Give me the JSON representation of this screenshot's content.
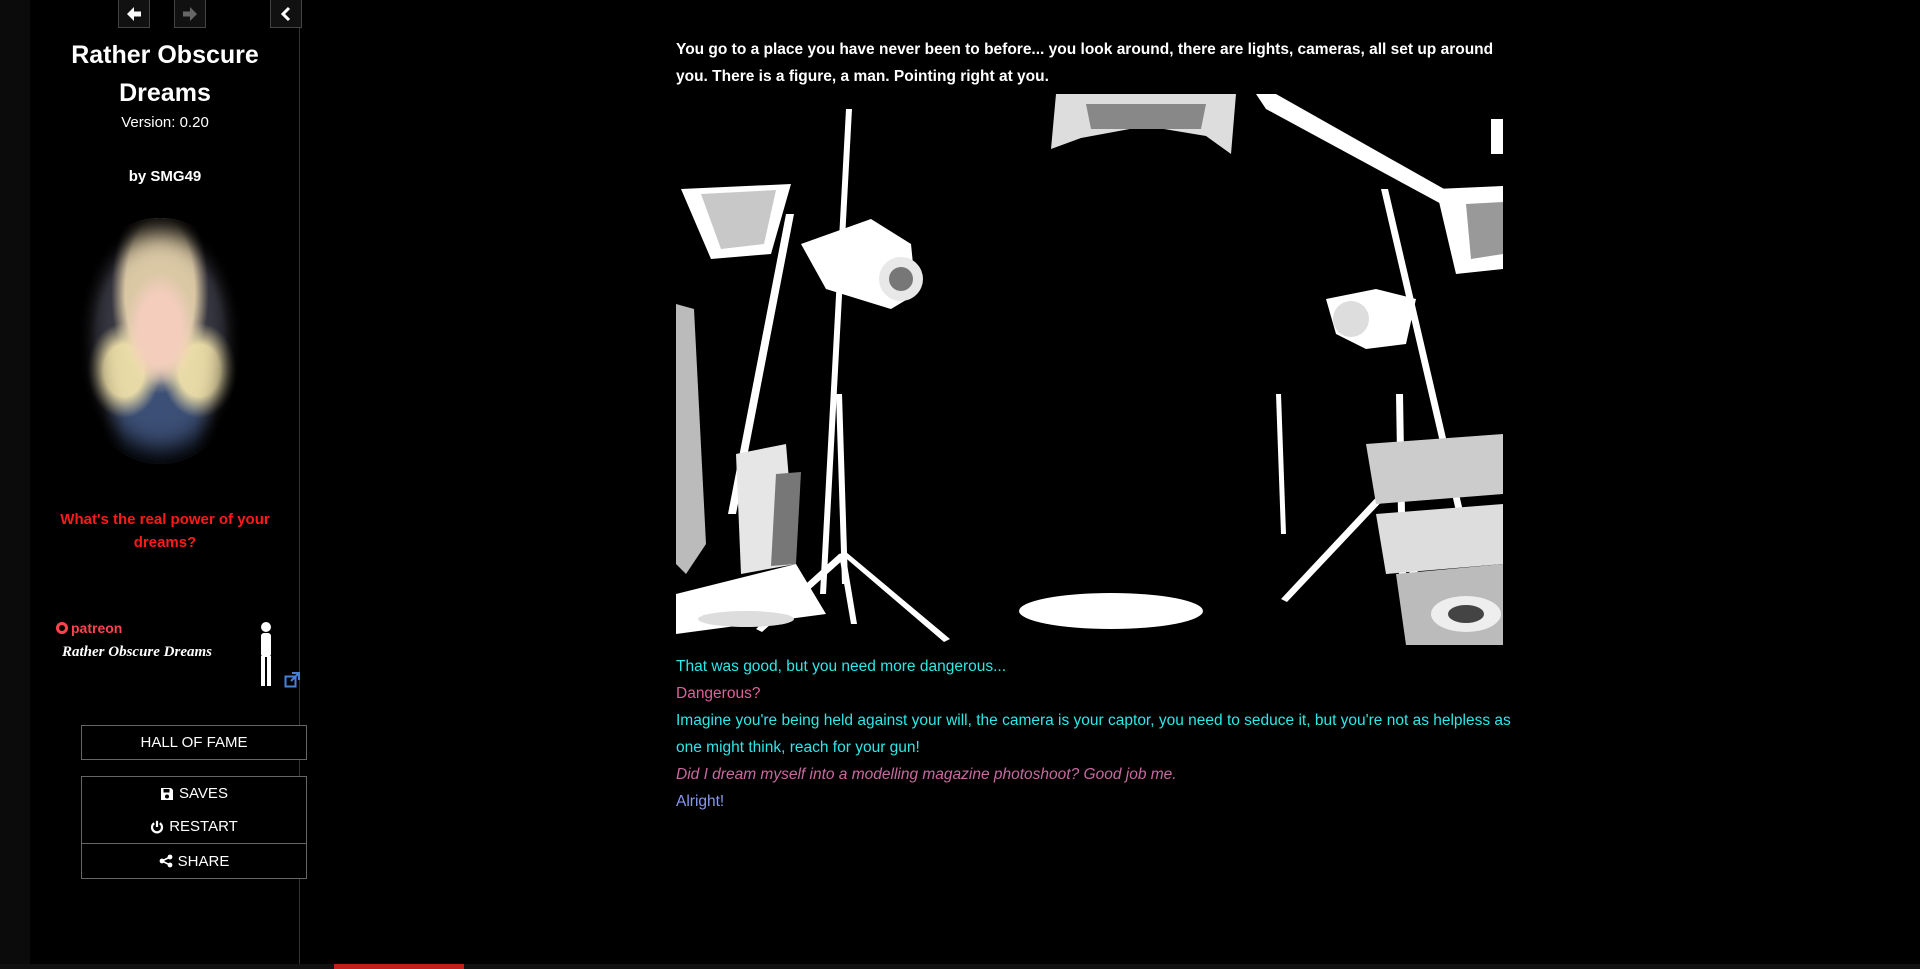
{
  "sidebar": {
    "title": "Rather Obscure Dreams",
    "version": "Version: 0.20",
    "author": "by SMG49",
    "tagline": "What's the real power of your dreams?",
    "banner": {
      "patreon_label": "patreon",
      "game_title": "Rather Obscure Dreams"
    },
    "menu": {
      "hall_of_fame": "HALL OF FAME",
      "saves": "SAVES",
      "restart": "RESTART",
      "share": "SHARE"
    }
  },
  "passage": {
    "intro": "You go to a place you have never been to before... you look around, there are lights, cameras, all set up around you. There is a figure, a man. Pointing right at you.",
    "lines": [
      {
        "text": "That was good, but you need more dangerous...",
        "color": "#2ee8e8"
      },
      {
        "text": "Dangerous?",
        "color": "#e0609a"
      },
      {
        "text": "Imagine you're being held against your will, the camera is your captor, you need to seduce it, but you're not as helpless as one might think, reach for your gun!",
        "color": "#2ee8e8"
      },
      {
        "text": "Did I dream myself into a modelling magazine photoshoot? Good job me.",
        "color": "#c86aa0"
      },
      {
        "text": "Alright!",
        "color": "#8899ee"
      }
    ]
  },
  "icons": {
    "back": "arrow-left-icon",
    "forward": "arrow-right-icon",
    "toggle": "chevron-left-icon",
    "saves": "floppy-disk-icon",
    "restart": "power-icon",
    "share": "share-icon",
    "external": "external-link-icon"
  }
}
